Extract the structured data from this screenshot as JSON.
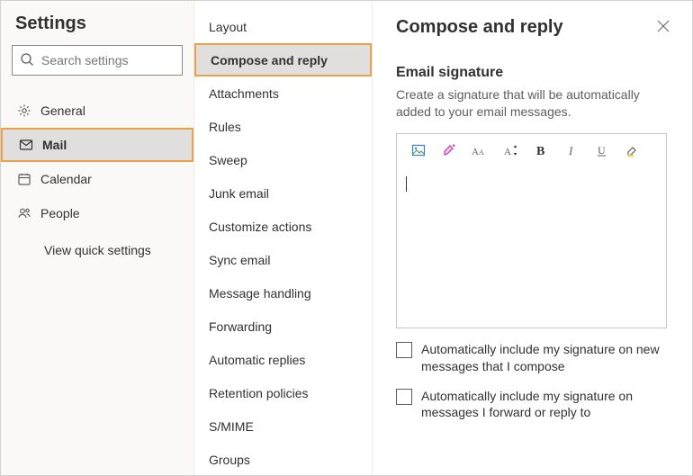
{
  "header": {
    "title": "Settings"
  },
  "search": {
    "placeholder": "Search settings",
    "value": ""
  },
  "primary_nav": {
    "items": [
      {
        "label": "General"
      },
      {
        "label": "Mail"
      },
      {
        "label": "Calendar"
      },
      {
        "label": "People"
      }
    ],
    "quick_settings": "View quick settings"
  },
  "secondary_nav": {
    "items": [
      {
        "label": "Layout"
      },
      {
        "label": "Compose and reply"
      },
      {
        "label": "Attachments"
      },
      {
        "label": "Rules"
      },
      {
        "label": "Sweep"
      },
      {
        "label": "Junk email"
      },
      {
        "label": "Customize actions"
      },
      {
        "label": "Sync email"
      },
      {
        "label": "Message handling"
      },
      {
        "label": "Forwarding"
      },
      {
        "label": "Automatic replies"
      },
      {
        "label": "Retention policies"
      },
      {
        "label": "S/MIME"
      },
      {
        "label": "Groups"
      }
    ]
  },
  "pane": {
    "title": "Compose and reply",
    "signature": {
      "heading": "Email signature",
      "description": "Create a signature that will be automatically added to your email messages.",
      "value": "",
      "option_new": "Automatically include my signature on new messages that I compose",
      "option_reply": "Automatically include my signature on messages I forward or reply to"
    }
  }
}
